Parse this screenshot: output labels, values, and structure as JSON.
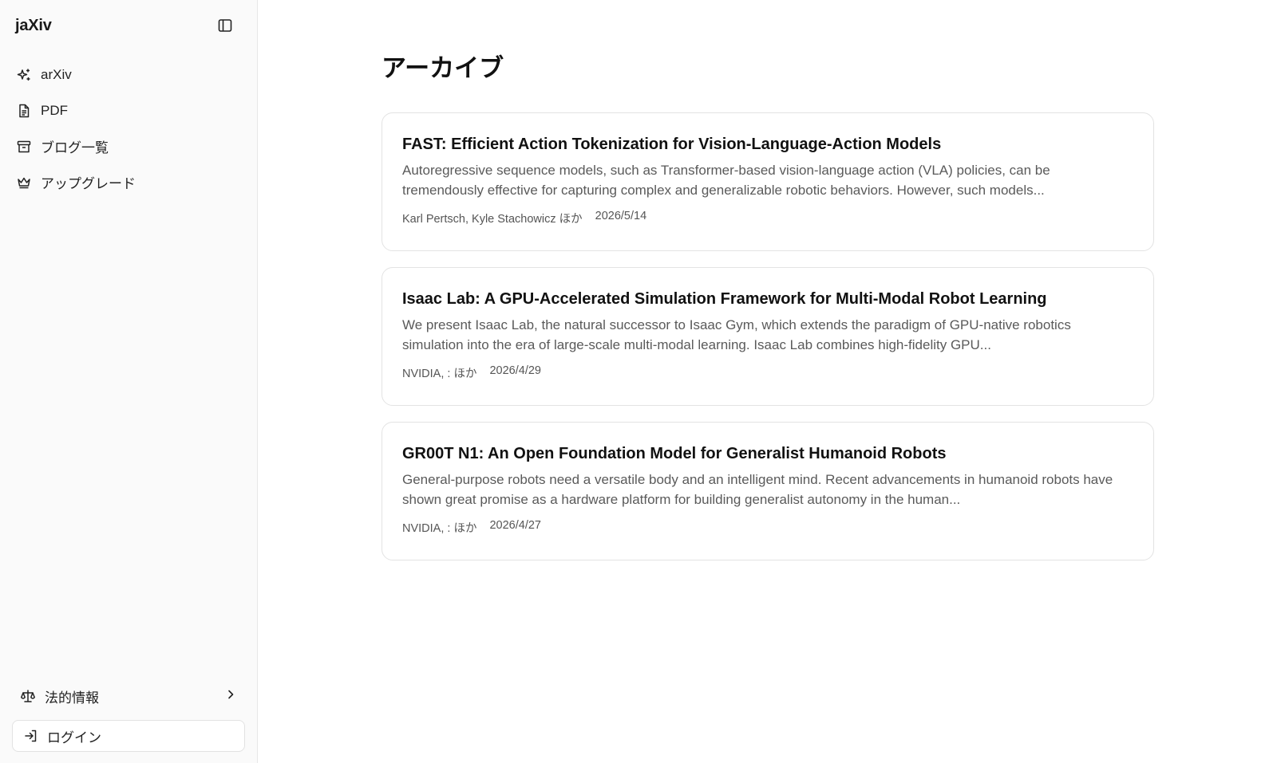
{
  "sidebar": {
    "brand": "jaXiv",
    "nav": [
      {
        "label": "arXiv",
        "icon": "sparkles-icon"
      },
      {
        "label": "PDF",
        "icon": "file-text-icon"
      },
      {
        "label": "ブログ一覧",
        "icon": "archive-icon"
      },
      {
        "label": "アップグレード",
        "icon": "crown-icon"
      }
    ],
    "legal_label": "法的情報",
    "login_label": "ログイン"
  },
  "main": {
    "title": "アーカイブ",
    "articles": [
      {
        "title": "FAST: Efficient Action Tokenization for Vision-Language-Action Models",
        "abstract": "Autoregressive sequence models, such as Transformer-based vision-language action (VLA) policies, can be tremendously effective for capturing complex and generalizable robotic behaviors. However, such models...",
        "authors": "Karl Pertsch, Kyle Stachowicz ほか",
        "date": "2026/5/14"
      },
      {
        "title": "Isaac Lab: A GPU-Accelerated Simulation Framework for Multi-Modal Robot Learning",
        "abstract": "We present Isaac Lab, the natural successor to Isaac Gym, which extends the paradigm of GPU-native robotics simulation into the era of large-scale multi-modal learning. Isaac Lab combines high-fidelity GPU...",
        "authors": "NVIDIA, : ほか",
        "date": "2026/4/29"
      },
      {
        "title": "GR00T N1: An Open Foundation Model for Generalist Humanoid Robots",
        "abstract": "General-purpose robots need a versatile body and an intelligent mind. Recent advancements in humanoid robots have shown great promise as a hardware platform for building generalist autonomy in the human...",
        "authors": "NVIDIA, : ほか",
        "date": "2026/4/27"
      }
    ]
  }
}
